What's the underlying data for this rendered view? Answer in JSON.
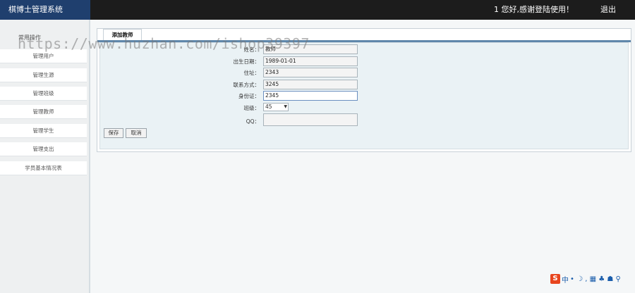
{
  "header": {
    "brand": "棋博士管理系统",
    "welcome": "1 您好,感谢登陆使用！",
    "logout": "退出"
  },
  "sidebar": {
    "title": "常用操作",
    "items": [
      "管理用户",
      "管理生源",
      "管理班级",
      "管理教师",
      "管理学生",
      "管理支出",
      "学员基本情况表"
    ]
  },
  "panel": {
    "tab": "添加教师",
    "fields": {
      "name": {
        "label": "姓名：",
        "value": "教师"
      },
      "birth": {
        "label": "出生日期：",
        "value": "1989-01-01"
      },
      "address": {
        "label": "住址：",
        "value": "2343"
      },
      "phone": {
        "label": "联系方式：",
        "value": "3245"
      },
      "idcard": {
        "label": "身份证：",
        "value": "2345"
      },
      "class": {
        "label": "班级：",
        "value": "45"
      },
      "qq": {
        "label": "QQ：",
        "value": ""
      }
    },
    "buttons": {
      "save": "保存",
      "cancel": "取消"
    }
  },
  "watermark": "https://www.huzhan.com/ishop39397",
  "ime": {
    "logo": "S",
    "mode": "中",
    "glyphs": "• ☽ , ▦ ♣ ☗ ⚲"
  }
}
